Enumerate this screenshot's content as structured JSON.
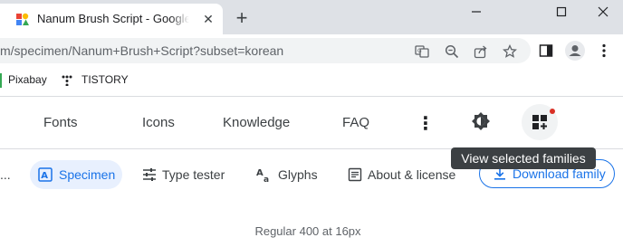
{
  "browser": {
    "tab": {
      "title": "Nanum Brush Script - Google Fonts",
      "close_glyph": "✕"
    },
    "new_tab_glyph": "+",
    "window_controls": [
      "minimize-icon",
      "maximize-icon",
      "close-icon"
    ],
    "address": {
      "url": "m/specimen/Nanum+Brush+Script?subset=korean"
    },
    "toolbar_icons": [
      "translate-icon",
      "zoom-icon",
      "share-icon",
      "star-icon",
      "sidebar-icon",
      "profile-icon",
      "menu-icon"
    ],
    "bookmarks": [
      {
        "label": "Pixabay"
      },
      {
        "label": "TISTORY"
      }
    ]
  },
  "site": {
    "nav": [
      "Fonts",
      "Icons",
      "Knowledge",
      "FAQ"
    ],
    "more_glyph": "⋮",
    "selected_families_tooltip": "View selected families",
    "accent_color": "#1a73e8"
  },
  "subnav": {
    "ellipsis": "...",
    "tabs": [
      {
        "label": "Specimen",
        "icon": "specimen-icon",
        "active": true
      },
      {
        "label": "Type tester",
        "icon": "sliders-icon",
        "active": false
      },
      {
        "label": "Glyphs",
        "icon": "glyphs-icon",
        "active": false
      },
      {
        "label": "About & license",
        "icon": "article-icon",
        "active": false
      }
    ],
    "download_label": "Download family"
  },
  "specimen": {
    "caption": "Regular 400 at 16px"
  }
}
